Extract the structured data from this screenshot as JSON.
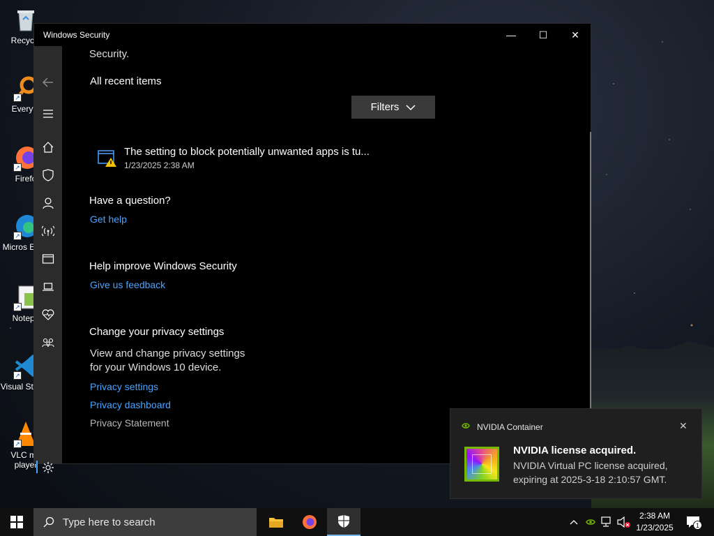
{
  "desktop": {
    "icons": [
      {
        "label": "Recycle"
      },
      {
        "label": "Everyth"
      },
      {
        "label": "Firefo"
      },
      {
        "label": "Micros Edge"
      },
      {
        "label": "Notepa"
      },
      {
        "label": "Visual St Cod"
      },
      {
        "label": "VLC me player"
      }
    ]
  },
  "window": {
    "title": "Windows Security",
    "minimize": "—",
    "maximize": "☐",
    "close": "✕"
  },
  "nav": [
    "back-arrow-icon",
    "menu-icon",
    "home-icon",
    "shield-icon",
    "account-icon",
    "wifi-icon",
    "browser-icon",
    "laptop-icon",
    "heart-icon",
    "family-icon",
    "gear-icon"
  ],
  "content": {
    "cut_text": "Security.",
    "recent_heading": "All recent items",
    "filters_label": "Filters",
    "item": {
      "title": "The setting to block potentially unwanted apps is tu...",
      "timestamp": "1/23/2025 2:38 AM"
    },
    "question": {
      "heading": "Have a question?",
      "link": "Get help"
    },
    "improve": {
      "heading": "Help improve Windows Security",
      "link": "Give us feedback"
    },
    "privacy": {
      "heading": "Change your privacy settings",
      "line1": "View and change privacy settings",
      "line2": "for your Windows 10 device.",
      "link1": "Privacy settings",
      "link2": "Privacy dashboard",
      "link3": "Privacy Statement"
    }
  },
  "toast": {
    "app_name": "NVIDIA Container",
    "close": "✕",
    "heading": "NVIDIA license acquired.",
    "line1": "NVIDIA Virtual PC license acquired,",
    "line2": "expiring at 2025-3-18 2:10:57 GMT."
  },
  "taskbar": {
    "search_placeholder": "Type here to search",
    "time": "2:38 AM",
    "date": "1/23/2025",
    "notification_count": "1"
  },
  "colors": {
    "link": "#4aa3ff",
    "accent": "#76b9ed",
    "nvidia": "#76b900"
  }
}
